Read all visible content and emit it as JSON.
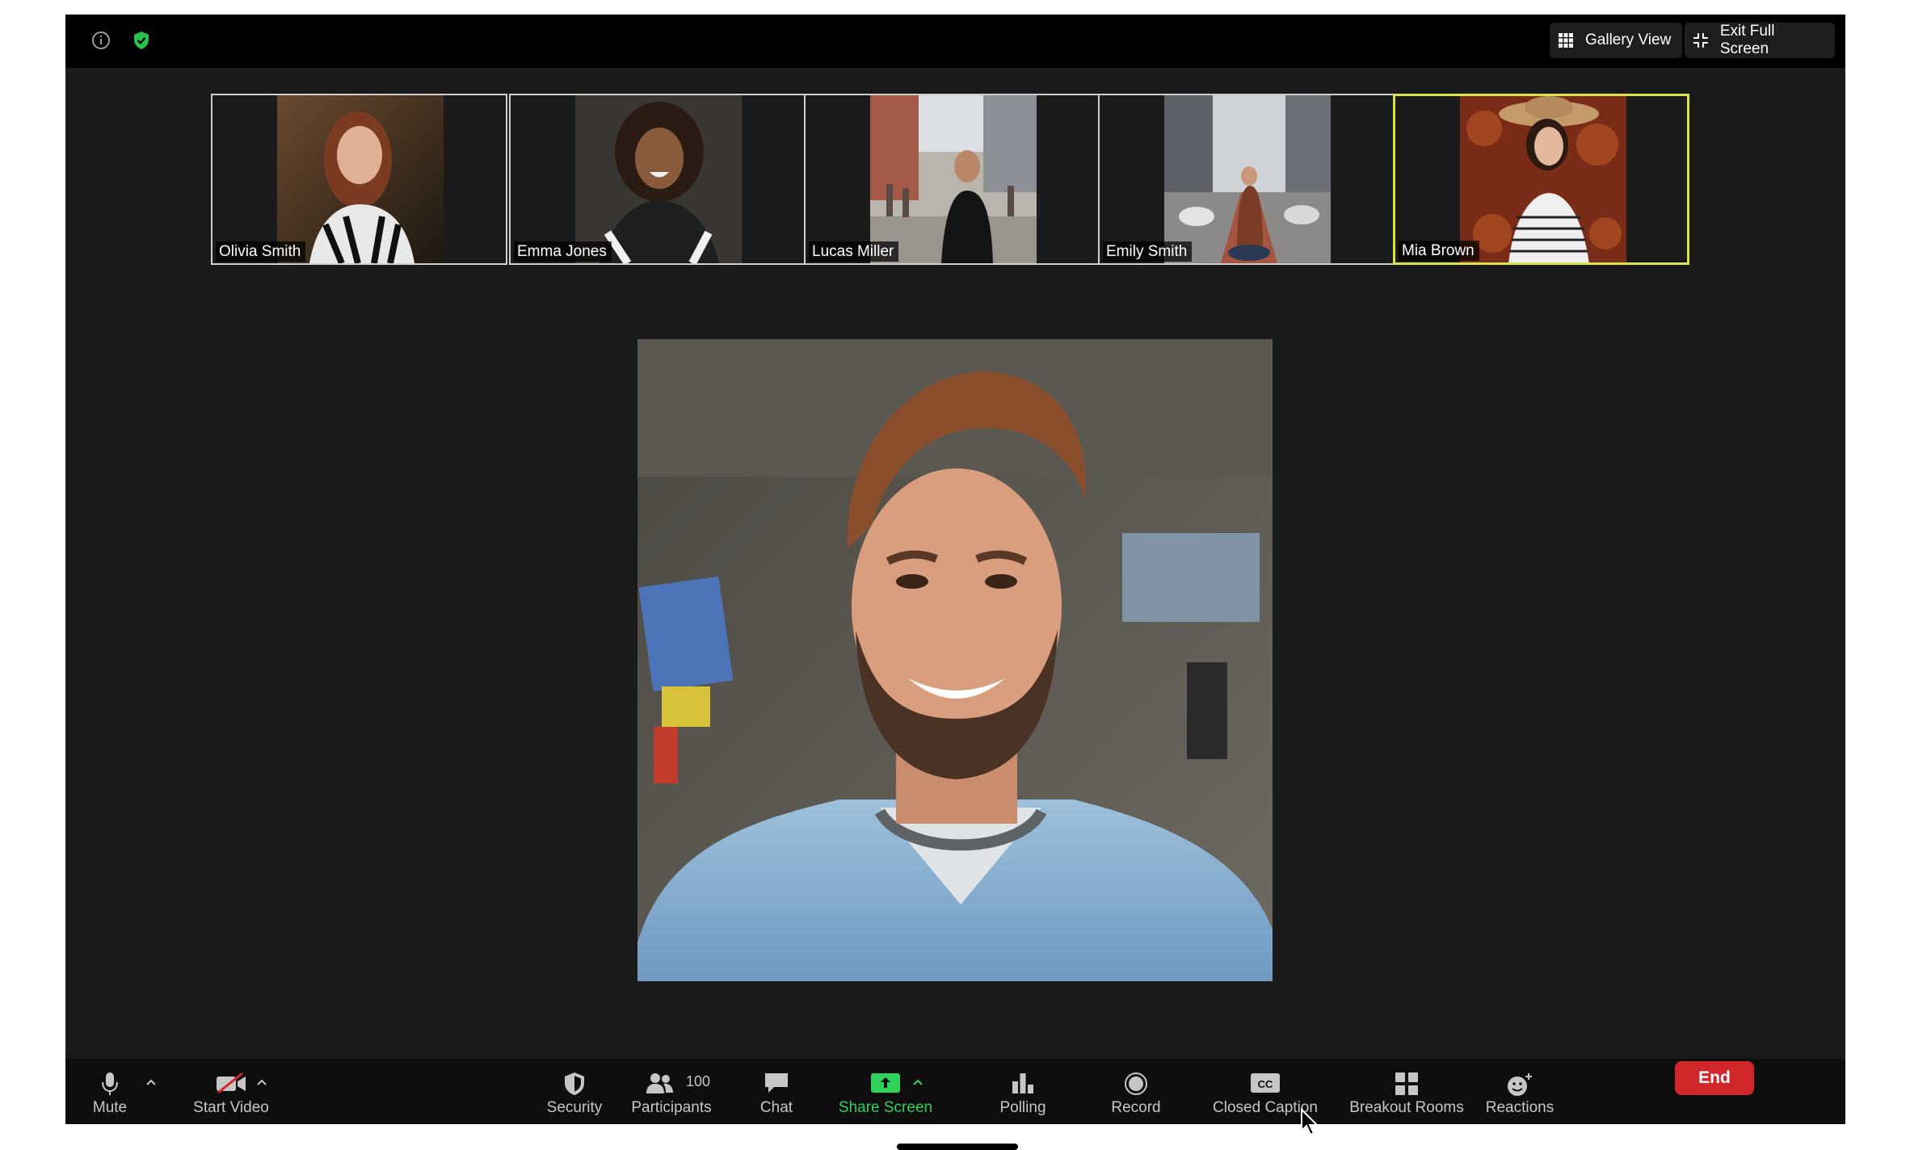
{
  "topbar": {
    "gallery_view_label": "Gallery View",
    "exit_fullscreen_label": "Exit Full Screen",
    "shield_color": "#27c24c"
  },
  "participants_strip": [
    {
      "name": "Olivia Smith",
      "active": false
    },
    {
      "name": "Emma Jones",
      "active": false
    },
    {
      "name": "Lucas Miller",
      "active": false
    },
    {
      "name": "Emily Smith",
      "active": false
    },
    {
      "name": "Mia Brown",
      "active": true
    }
  ],
  "toolbar": {
    "mute_label": "Mute",
    "start_video_label": "Start Video",
    "security_label": "Security",
    "participants_label": "Participants",
    "participants_count": "100",
    "chat_label": "Chat",
    "share_screen_label": "Share Screen",
    "polling_label": "Polling",
    "record_label": "Record",
    "closed_caption_label": "Closed Caption",
    "closed_caption_icon_text": "CC",
    "breakout_rooms_label": "Breakout Rooms",
    "reactions_label": "Reactions",
    "end_label": "End"
  },
  "colors": {
    "accent_green": "#2fd25a",
    "end_red": "#d0272b",
    "active_speaker_border": "#d9e34a"
  }
}
